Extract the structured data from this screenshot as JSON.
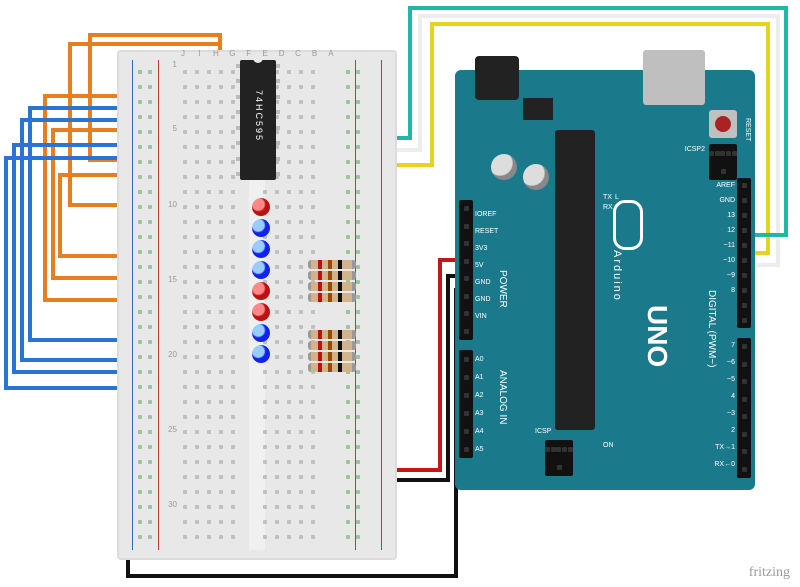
{
  "watermark": "fritzing",
  "breadboard": {
    "cols_top": [
      "J",
      "I",
      "H",
      "G",
      "F",
      "E",
      "D",
      "C",
      "B",
      "A"
    ],
    "row_numbers": [
      "1",
      "5",
      "10",
      "15",
      "20",
      "25",
      "30"
    ]
  },
  "ic": {
    "label": "74HC595"
  },
  "arduino": {
    "brand": "Arduino",
    "model": "UNO",
    "reset_label": "RESET",
    "section_power": "POWER",
    "section_analog": "ANALOG IN",
    "section_digital": "DIGITAL (PWM~)",
    "icsp2": "ICSP2",
    "icsp": "ICSP",
    "tx": "TX",
    "rx": "RX",
    "on": "ON",
    "L": "L",
    "pin_labels_power": [
      "IOREF",
      "RESET",
      "3V3",
      "5V",
      "GND",
      "GND",
      "VIN"
    ],
    "pin_labels_analog": [
      "A0",
      "A1",
      "A2",
      "A3",
      "A4",
      "A5"
    ],
    "pin_labels_digital_a": [
      "AREF",
      "GND",
      "13",
      "12",
      "~11",
      "~10",
      "~9",
      "8"
    ],
    "pin_labels_digital_b": [
      "7",
      "~6",
      "~5",
      "4",
      "~3",
      "2",
      "TX→1",
      "RX←0"
    ]
  },
  "wires": {
    "colors": {
      "orange": "#e67e22",
      "blue": "#2b74d1",
      "green": "#1c9a42",
      "black": "#111111",
      "red": "#c31818",
      "yellow": "#e7d21c",
      "white": "#eceeee",
      "cyan": "#1fb8a6"
    }
  },
  "components": {
    "leds": [
      {
        "color": "red",
        "row": 7
      },
      {
        "color": "blue",
        "row": 8
      },
      {
        "color": "blue",
        "row": 9
      },
      {
        "color": "blue",
        "row": 10
      },
      {
        "color": "red",
        "row": 11
      },
      {
        "color": "red",
        "row": 11.8
      },
      {
        "color": "blue",
        "row": 13
      },
      {
        "color": "blue",
        "row": 14
      }
    ],
    "resistors_group1_count": 4,
    "resistors_group2_count": 4
  }
}
